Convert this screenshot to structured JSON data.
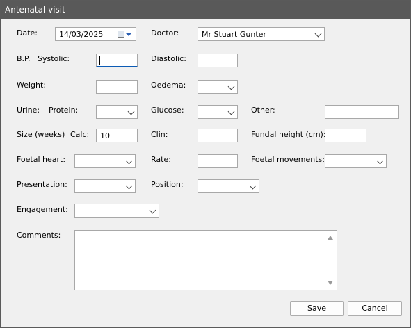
{
  "window": {
    "title": "Antenatal visit"
  },
  "labels": {
    "date": "Date:",
    "doctor": "Doctor:",
    "bp": "B.P.",
    "systolic": "Systolic:",
    "diastolic": "Diastolic:",
    "weight": "Weight:",
    "oedema": "Oedema:",
    "urine": "Urine:",
    "protein": "Protein:",
    "glucose": "Glucose:",
    "other": "Other:",
    "size_weeks": "Size (weeks)",
    "calc": "Calc:",
    "clin": "Clin:",
    "fundal_height": "Fundal height (cm):",
    "foetal_heart": "Foetal heart:",
    "rate": "Rate:",
    "foetal_movements": "Foetal movements:",
    "presentation": "Presentation:",
    "position": "Position:",
    "engagement": "Engagement:",
    "comments": "Comments:"
  },
  "values": {
    "date": "14/03/2025",
    "doctor": "Mr Stuart Gunter",
    "systolic": "",
    "diastolic": "",
    "weight": "",
    "oedema": "",
    "protein": "",
    "glucose": "",
    "other": "",
    "calc": "10",
    "clin": "",
    "fundal_height": "",
    "foetal_heart": "",
    "rate": "",
    "foetal_movements": "",
    "presentation": "",
    "position": "",
    "engagement": "",
    "comments": ""
  },
  "buttons": {
    "save": "Save",
    "cancel": "Cancel"
  },
  "icons": {
    "date_picker": "calendar-icon",
    "dropdown": "chevron-down-icon",
    "scroll_up": "scroll-up-arrow-icon",
    "scroll_down": "scroll-down-arrow-icon"
  }
}
